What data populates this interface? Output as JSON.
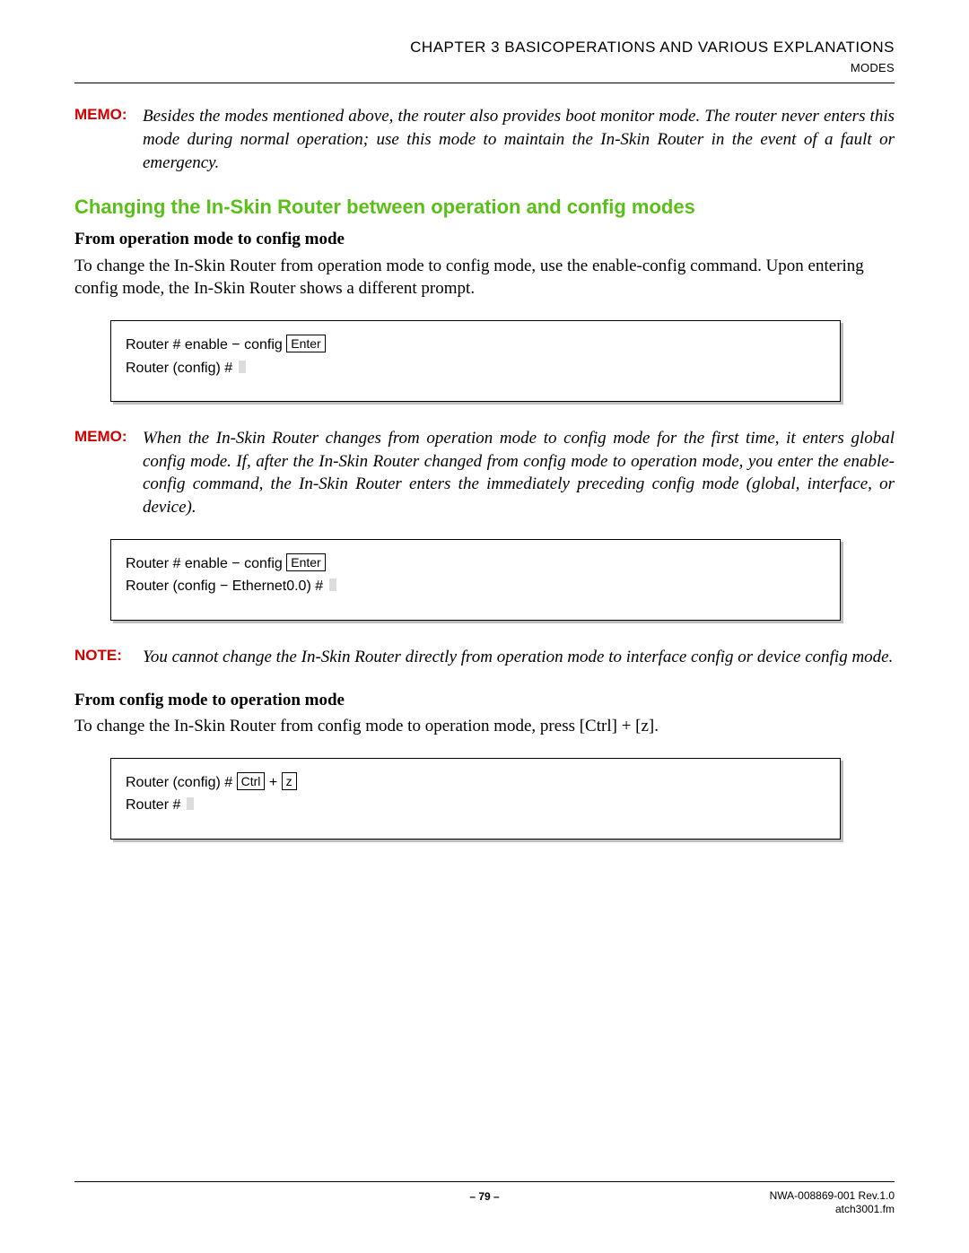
{
  "header": {
    "chapter": "CHAPTER 3   BASICOPERATIONS AND VARIOUS EXPLANATIONS",
    "sub": "MODES"
  },
  "memo1": {
    "label": "MEMO:",
    "body": "Besides the modes mentioned above, the router also provides boot monitor mode. The router never enters this mode during normal operation; use this mode to maintain the In-Skin Router in the event of a fault or emergency."
  },
  "h2": "Changing the In-Skin Router between operation and config modes",
  "sec1": {
    "title": "From operation mode to config mode",
    "para": "To change the In-Skin Router from operation mode to config mode, use the enable-config command. Upon entering config mode, the In-Skin Router shows a different prompt."
  },
  "code1": {
    "line1_pre": "Router # enable − config ",
    "line1_key": "Enter",
    "line2": "Router (config) # "
  },
  "memo2": {
    "label": "MEMO:",
    "body": "When the In-Skin Router changes from operation mode to config mode for the first time, it enters global config mode. If, after the In-Skin Router changed from config mode to operation mode, you enter the enable-config command, the In-Skin Router enters the immediately preceding config mode (global, interface, or device)."
  },
  "code2": {
    "line1_pre": "Router # enable − config ",
    "line1_key": "Enter",
    "line2": "Router (config − Ethernet0.0) # "
  },
  "note1": {
    "label": "NOTE:",
    "body": "You cannot change the In-Skin Router directly from operation mode to interface config or device config mode."
  },
  "sec2": {
    "title": "From config mode to operation mode",
    "para": "To change the In-Skin Router from config mode to operation mode, press [Ctrl] + [z]."
  },
  "code3": {
    "line1_a": "Router (config) #  ",
    "line1_k1": "Ctrl",
    "line1_mid": " + ",
    "line1_k2": "z",
    "line2": "Router # "
  },
  "footer": {
    "page": "– 79 –",
    "doc": "NWA-008869-001 Rev.1.0",
    "file": "atch3001.fm"
  }
}
